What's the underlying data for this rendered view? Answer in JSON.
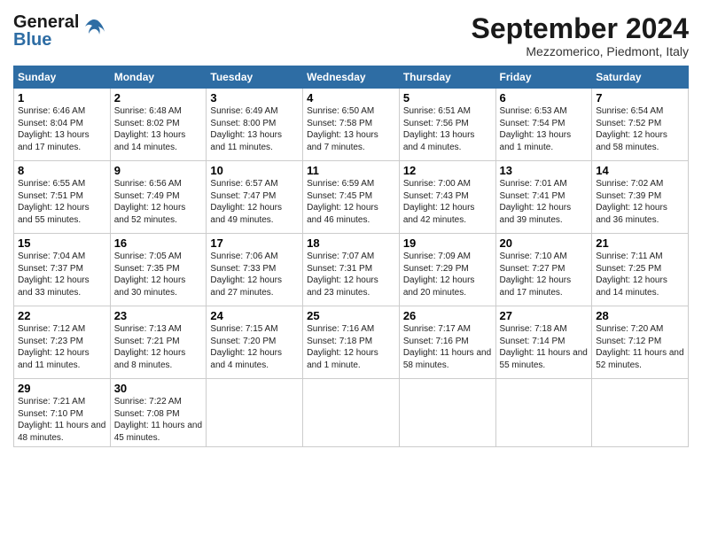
{
  "header": {
    "logo_line1": "General",
    "logo_line2": "Blue",
    "month_title": "September 2024",
    "location": "Mezzomerico, Piedmont, Italy"
  },
  "days_of_week": [
    "Sunday",
    "Monday",
    "Tuesday",
    "Wednesday",
    "Thursday",
    "Friday",
    "Saturday"
  ],
  "weeks": [
    [
      {
        "day": "1",
        "sunrise": "Sunrise: 6:46 AM",
        "sunset": "Sunset: 8:04 PM",
        "daylight": "Daylight: 13 hours and 17 minutes."
      },
      {
        "day": "2",
        "sunrise": "Sunrise: 6:48 AM",
        "sunset": "Sunset: 8:02 PM",
        "daylight": "Daylight: 13 hours and 14 minutes."
      },
      {
        "day": "3",
        "sunrise": "Sunrise: 6:49 AM",
        "sunset": "Sunset: 8:00 PM",
        "daylight": "Daylight: 13 hours and 11 minutes."
      },
      {
        "day": "4",
        "sunrise": "Sunrise: 6:50 AM",
        "sunset": "Sunset: 7:58 PM",
        "daylight": "Daylight: 13 hours and 7 minutes."
      },
      {
        "day": "5",
        "sunrise": "Sunrise: 6:51 AM",
        "sunset": "Sunset: 7:56 PM",
        "daylight": "Daylight: 13 hours and 4 minutes."
      },
      {
        "day": "6",
        "sunrise": "Sunrise: 6:53 AM",
        "sunset": "Sunset: 7:54 PM",
        "daylight": "Daylight: 13 hours and 1 minute."
      },
      {
        "day": "7",
        "sunrise": "Sunrise: 6:54 AM",
        "sunset": "Sunset: 7:52 PM",
        "daylight": "Daylight: 12 hours and 58 minutes."
      }
    ],
    [
      {
        "day": "8",
        "sunrise": "Sunrise: 6:55 AM",
        "sunset": "Sunset: 7:51 PM",
        "daylight": "Daylight: 12 hours and 55 minutes."
      },
      {
        "day": "9",
        "sunrise": "Sunrise: 6:56 AM",
        "sunset": "Sunset: 7:49 PM",
        "daylight": "Daylight: 12 hours and 52 minutes."
      },
      {
        "day": "10",
        "sunrise": "Sunrise: 6:57 AM",
        "sunset": "Sunset: 7:47 PM",
        "daylight": "Daylight: 12 hours and 49 minutes."
      },
      {
        "day": "11",
        "sunrise": "Sunrise: 6:59 AM",
        "sunset": "Sunset: 7:45 PM",
        "daylight": "Daylight: 12 hours and 46 minutes."
      },
      {
        "day": "12",
        "sunrise": "Sunrise: 7:00 AM",
        "sunset": "Sunset: 7:43 PM",
        "daylight": "Daylight: 12 hours and 42 minutes."
      },
      {
        "day": "13",
        "sunrise": "Sunrise: 7:01 AM",
        "sunset": "Sunset: 7:41 PM",
        "daylight": "Daylight: 12 hours and 39 minutes."
      },
      {
        "day": "14",
        "sunrise": "Sunrise: 7:02 AM",
        "sunset": "Sunset: 7:39 PM",
        "daylight": "Daylight: 12 hours and 36 minutes."
      }
    ],
    [
      {
        "day": "15",
        "sunrise": "Sunrise: 7:04 AM",
        "sunset": "Sunset: 7:37 PM",
        "daylight": "Daylight: 12 hours and 33 minutes."
      },
      {
        "day": "16",
        "sunrise": "Sunrise: 7:05 AM",
        "sunset": "Sunset: 7:35 PM",
        "daylight": "Daylight: 12 hours and 30 minutes."
      },
      {
        "day": "17",
        "sunrise": "Sunrise: 7:06 AM",
        "sunset": "Sunset: 7:33 PM",
        "daylight": "Daylight: 12 hours and 27 minutes."
      },
      {
        "day": "18",
        "sunrise": "Sunrise: 7:07 AM",
        "sunset": "Sunset: 7:31 PM",
        "daylight": "Daylight: 12 hours and 23 minutes."
      },
      {
        "day": "19",
        "sunrise": "Sunrise: 7:09 AM",
        "sunset": "Sunset: 7:29 PM",
        "daylight": "Daylight: 12 hours and 20 minutes."
      },
      {
        "day": "20",
        "sunrise": "Sunrise: 7:10 AM",
        "sunset": "Sunset: 7:27 PM",
        "daylight": "Daylight: 12 hours and 17 minutes."
      },
      {
        "day": "21",
        "sunrise": "Sunrise: 7:11 AM",
        "sunset": "Sunset: 7:25 PM",
        "daylight": "Daylight: 12 hours and 14 minutes."
      }
    ],
    [
      {
        "day": "22",
        "sunrise": "Sunrise: 7:12 AM",
        "sunset": "Sunset: 7:23 PM",
        "daylight": "Daylight: 12 hours and 11 minutes."
      },
      {
        "day": "23",
        "sunrise": "Sunrise: 7:13 AM",
        "sunset": "Sunset: 7:21 PM",
        "daylight": "Daylight: 12 hours and 8 minutes."
      },
      {
        "day": "24",
        "sunrise": "Sunrise: 7:15 AM",
        "sunset": "Sunset: 7:20 PM",
        "daylight": "Daylight: 12 hours and 4 minutes."
      },
      {
        "day": "25",
        "sunrise": "Sunrise: 7:16 AM",
        "sunset": "Sunset: 7:18 PM",
        "daylight": "Daylight: 12 hours and 1 minute."
      },
      {
        "day": "26",
        "sunrise": "Sunrise: 7:17 AM",
        "sunset": "Sunset: 7:16 PM",
        "daylight": "Daylight: 11 hours and 58 minutes."
      },
      {
        "day": "27",
        "sunrise": "Sunrise: 7:18 AM",
        "sunset": "Sunset: 7:14 PM",
        "daylight": "Daylight: 11 hours and 55 minutes."
      },
      {
        "day": "28",
        "sunrise": "Sunrise: 7:20 AM",
        "sunset": "Sunset: 7:12 PM",
        "daylight": "Daylight: 11 hours and 52 minutes."
      }
    ],
    [
      {
        "day": "29",
        "sunrise": "Sunrise: 7:21 AM",
        "sunset": "Sunset: 7:10 PM",
        "daylight": "Daylight: 11 hours and 48 minutes."
      },
      {
        "day": "30",
        "sunrise": "Sunrise: 7:22 AM",
        "sunset": "Sunset: 7:08 PM",
        "daylight": "Daylight: 11 hours and 45 minutes."
      },
      null,
      null,
      null,
      null,
      null
    ]
  ]
}
